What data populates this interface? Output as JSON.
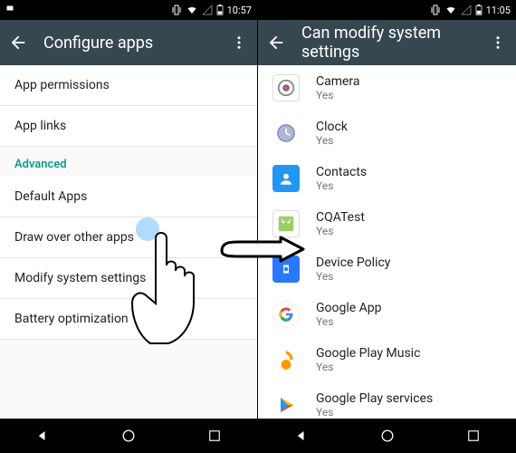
{
  "left": {
    "statusbar": {
      "time": "10:57"
    },
    "appbar": {
      "title": "Configure apps"
    },
    "rows_top": [
      "App permissions",
      "App links"
    ],
    "section": "Advanced",
    "rows_adv": [
      "Default Apps",
      "Draw over other apps",
      "Modify system settings",
      "Battery optimization"
    ]
  },
  "right": {
    "statusbar": {
      "time": "11:05"
    },
    "appbar": {
      "title": "Can modify system settings"
    },
    "apps": [
      {
        "name": "Camera",
        "sub": "Yes",
        "icon": "camera"
      },
      {
        "name": "Clock",
        "sub": "Yes",
        "icon": "clock"
      },
      {
        "name": "Contacts",
        "sub": "Yes",
        "icon": "contacts"
      },
      {
        "name": "CQATest",
        "sub": "Yes",
        "icon": "cqa"
      },
      {
        "name": "Device Policy",
        "sub": "Yes",
        "icon": "device"
      },
      {
        "name": "Google App",
        "sub": "Yes",
        "icon": "google"
      },
      {
        "name": "Google Play Music",
        "sub": "Yes",
        "icon": "music"
      },
      {
        "name": "Google Play services",
        "sub": "Yes",
        "icon": "play"
      }
    ]
  }
}
